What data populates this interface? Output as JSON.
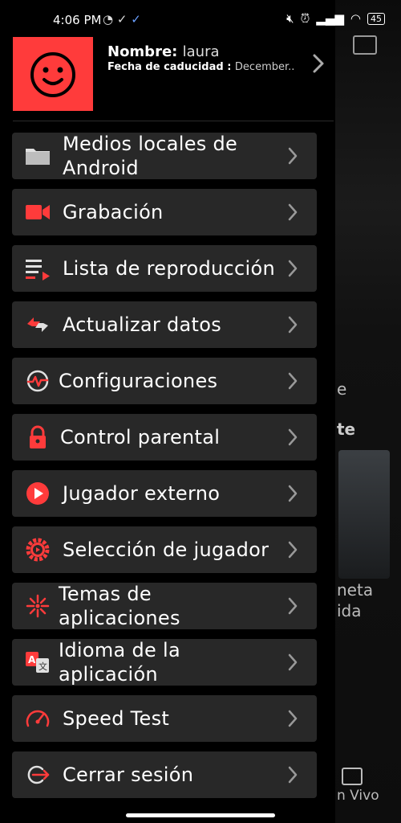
{
  "status_bar": {
    "time": "4:06 PM",
    "battery": "45"
  },
  "header": {
    "name_label": "Nombre:",
    "name_value": "laura",
    "expiry_label": "Fecha de caducidad :",
    "expiry_value": "December.."
  },
  "background": {
    "text_e": "e",
    "text_te": "te",
    "text_neta": "neta",
    "text_ida": "ida",
    "text_en_vivo": "n Vivo"
  },
  "menu": [
    {
      "label": "Medios locales de Android",
      "icon": "folder-icon"
    },
    {
      "label": "Grabación",
      "icon": "video-camera-icon"
    },
    {
      "label": "Lista de reproducción",
      "icon": "playlist-icon"
    },
    {
      "label": "Actualizar datos",
      "icon": "refresh-icon"
    },
    {
      "label": "Configuraciones",
      "icon": "settings-pulse-icon"
    },
    {
      "label": "Control parental",
      "icon": "lock-icon"
    },
    {
      "label": "Jugador externo",
      "icon": "play-circle-icon"
    },
    {
      "label": "Selección de jugador",
      "icon": "player-gear-icon"
    },
    {
      "label": "Temas de aplicaciones",
      "icon": "theme-burst-icon"
    },
    {
      "label": "Idioma de la aplicación",
      "icon": "translate-icon"
    },
    {
      "label": "Speed Test",
      "icon": "speedometer-icon"
    },
    {
      "label": "Cerrar sesión",
      "icon": "logout-icon"
    }
  ],
  "colors": {
    "accent": "#ff3b3b",
    "item_bg": "#282828",
    "drawer_bg": "#000000"
  }
}
